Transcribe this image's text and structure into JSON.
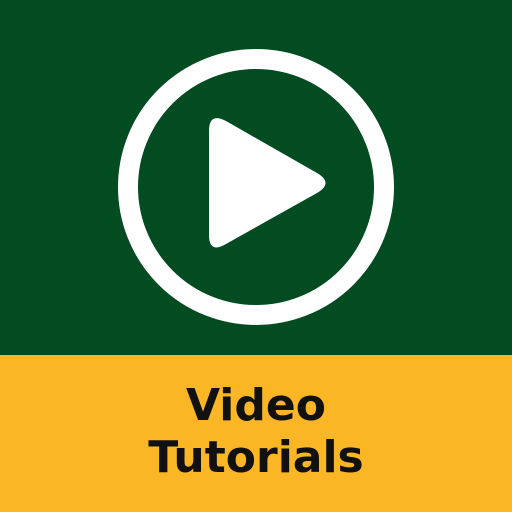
{
  "colors": {
    "top_background": "#034b20",
    "bottom_background": "#fbb625",
    "icon_color": "#ffffff",
    "text_color": "#111111"
  },
  "icon": {
    "name": "play-circle-icon"
  },
  "caption": {
    "line1": "Video",
    "line2": "Tutorials"
  }
}
